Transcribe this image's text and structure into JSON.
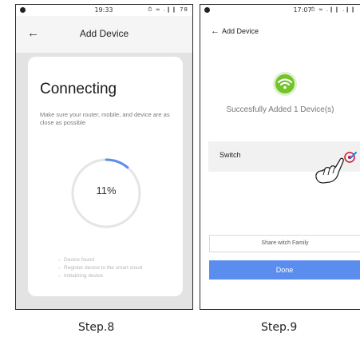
{
  "step8": {
    "status_time": "19:33",
    "status_icons": "⏱ ≈ .❙❙ 78",
    "header_title": "Add Device",
    "card_title": "Connecting",
    "card_desc": "Make sure your router, mobile, and device are as close as possible",
    "progress": {
      "percent": 11,
      "label": "11%",
      "arc_color": "#5b8def",
      "track_color": "#e5e5e5"
    },
    "steps": [
      "Device found",
      "Register device to the smart cloud",
      "Initializing device"
    ],
    "caption": "Step.8"
  },
  "step9": {
    "status_time": "17:07",
    "status_icons": "⏱ ≈ .❙❙ .❙❙",
    "header_title": "Add Device",
    "success_text": "Succesfully Added 1 Device(s)",
    "device_name": "Switch",
    "share_label": "Share witch Family",
    "done_label": "Done",
    "caption": "Step.9"
  },
  "colors": {
    "accent": "#5b8def",
    "wifi_green": "#73c32a",
    "highlight_red": "#d0102a"
  }
}
